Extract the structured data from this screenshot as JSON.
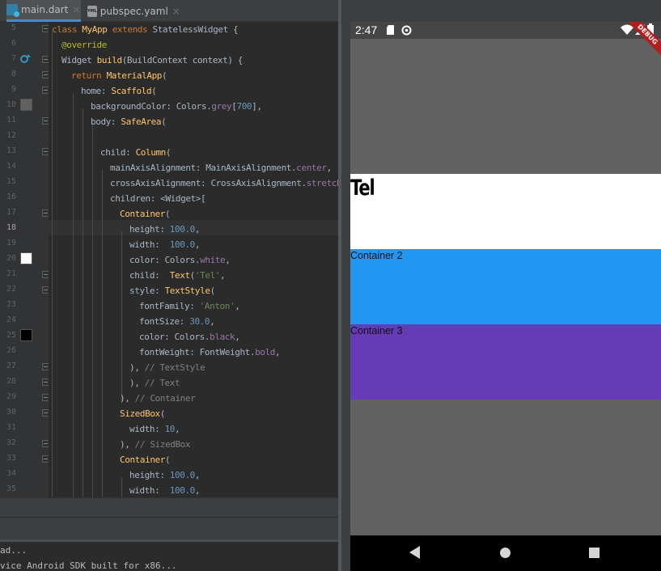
{
  "ide": {
    "tabs": [
      {
        "label": "main.dart",
        "icon": "dart-file-icon",
        "active": true
      },
      {
        "label": "pubspec.yaml",
        "icon": "yaml-file-icon",
        "active": false
      }
    ],
    "tab_close": "×",
    "yaml_badge": "YML",
    "line_numbers": [
      "5",
      "6",
      "7",
      "8",
      "9",
      "10",
      "11",
      "12",
      "13",
      "14",
      "15",
      "16",
      "17",
      "18",
      "19",
      "20",
      "21",
      "22",
      "23",
      "24",
      "25",
      "26",
      "27",
      "28",
      "29",
      "30",
      "31",
      "32",
      "33",
      "34",
      "35"
    ],
    "current_line": "18",
    "code": {
      "l5a": "class ",
      "l5b": "MyApp ",
      "l5c": "extends ",
      "l5d": "StatelessWidget {",
      "l6": "@override",
      "l7a": "Widget ",
      "l7b": "build",
      "l7c": "(BuildContext context) {",
      "l8a": "return ",
      "l8b": "MaterialApp",
      "l8c": "(",
      "l9a": "home: ",
      "l9b": "Scaffold",
      "l9c": "(",
      "l10a": "backgroundColor: Colors.",
      "l10b": "grey",
      "l10c": "[",
      "l10d": "700",
      "l10e": "],",
      "l11a": "body: ",
      "l11b": "SafeArea",
      "l11c": "(",
      "l13a": "child: ",
      "l13b": "Column",
      "l13c": "(",
      "l14a": "mainAxisAlignment: MainAxisAlignment.",
      "l14b": "center",
      "l14c": ",",
      "l15a": "crossAxisAlignment: CrossAxisAlignment.",
      "l15b": "stretch",
      "l15c": ",",
      "l16": "children: <Widget>[",
      "l17a": "Container",
      "l17b": "(",
      "l18a": "height: ",
      "l18b": "100.0",
      "l18c": ",",
      "l19a": "width:  ",
      "l19b": "100.0",
      "l19c": ",",
      "l20a": "color: Colors.",
      "l20b": "white",
      "l20c": ",",
      "l21a": "child:  ",
      "l21b": "Text",
      "l21c": "(",
      "l21d": "'Tel'",
      "l21e": ",",
      "l22a": "style: ",
      "l22b": "TextStyle",
      "l22c": "(",
      "l23a": "fontFamily: ",
      "l23b": "'Anton'",
      "l23c": ",",
      "l24a": "fontSize: ",
      "l24b": "30.0",
      "l24c": ",",
      "l25a": "color: Colors.",
      "l25b": "black",
      "l25c": ",",
      "l26a": "fontWeight: FontWeight.",
      "l26b": "bold",
      "l26c": ",",
      "l27a": "), ",
      "l27b": "// TextStyle",
      "l28a": "), ",
      "l28b": "// Text",
      "l29a": "), ",
      "l29b": "// Container",
      "l30a": "SizedBox",
      "l30b": "(",
      "l31a": "width: ",
      "l31b": "10",
      "l31c": ",",
      "l32a": "), ",
      "l32b": "// SizedBox",
      "l33a": "Container",
      "l33b": "(",
      "l34a": "height: ",
      "l34b": "100.0",
      "l34c": ",",
      "l35a": "width:  ",
      "l35b": "100.0",
      "l35c": ","
    },
    "console": [
      "ad...",
      "vice Android SDK built for x86..."
    ]
  },
  "emulator": {
    "status_time": "2:47",
    "debug_banner": "DEBUG",
    "container1_text": "Tel",
    "container2_text": "Container 2",
    "container3_text": "Container 3",
    "colors": {
      "background": "#616161",
      "container1": "#ffffff",
      "container2": "#2196f3",
      "container3": "#673ab7"
    }
  }
}
